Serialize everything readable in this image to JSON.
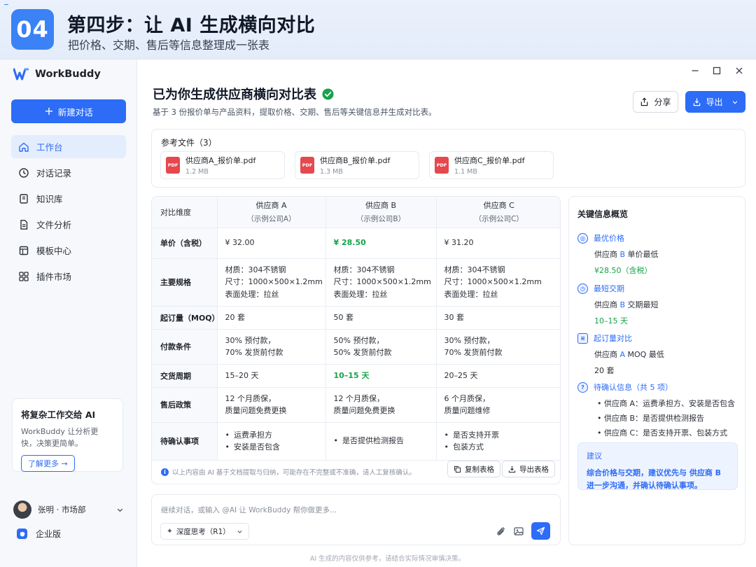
{
  "banner": {
    "step_number": "04",
    "title": "第四步：让 AI 生成横向对比",
    "subtitle": "把价格、交期、售后等信息整理成一张表"
  },
  "app": {
    "name": "WorkBuddy",
    "new_chat": "新建对话"
  },
  "sidebar": {
    "items": [
      {
        "label": "工作台",
        "icon": "home-icon"
      },
      {
        "label": "对话记录",
        "icon": "clock-icon"
      },
      {
        "label": "知识库",
        "icon": "book-icon"
      },
      {
        "label": "文件分析",
        "icon": "file-icon"
      },
      {
        "label": "模板中心",
        "icon": "template-icon"
      },
      {
        "label": "插件市场",
        "icon": "grid-icon"
      }
    ],
    "promo": {
      "title": "将复杂工作交给 AI",
      "desc": "WorkBuddy 让分析更快，决策更简单。",
      "button": "了解更多 →"
    },
    "user": {
      "name": "张明 · 市场部"
    },
    "edition": "企业版"
  },
  "main": {
    "title": "已为你生成供应商横向对比表",
    "subtitle": "基于 3 份报价单与产品资料，提取价格、交期、售后等关键信息并生成对比表。",
    "share": "分享",
    "export": "导出"
  },
  "refs": {
    "title": "参考文件（3）",
    "files": [
      {
        "name": "供应商A_报价单.pdf",
        "size": "1.2 MB"
      },
      {
        "name": "供应商B_报价单.pdf",
        "size": "1.3 MB"
      },
      {
        "name": "供应商C_报价单.pdf",
        "size": "1.1 MB"
      }
    ],
    "pdf_label": "PDF"
  },
  "table": {
    "dim_header": "对比维度",
    "columns": [
      {
        "name": "供应商 A",
        "sub": "（示例公司A）"
      },
      {
        "name": "供应商 B",
        "sub": "（示例公司B）"
      },
      {
        "name": "供应商 C",
        "sub": "（示例公司C）"
      }
    ],
    "rows": [
      {
        "dim": "单价（含税）",
        "cells": [
          [
            "¥ 32.00"
          ],
          [
            "¥ 28.50"
          ],
          [
            "¥ 31.20"
          ]
        ],
        "highlight": 1
      },
      {
        "dim": "主要规格",
        "cells": [
          [
            "材质：304不锈钢",
            "尺寸：1000×500×1.2mm",
            "表面处理：拉丝"
          ],
          [
            "材质：304不锈钢",
            "尺寸：1000×500×1.2mm",
            "表面处理：拉丝"
          ],
          [
            "材质：304不锈钢",
            "尺寸：1000×500×1.2mm",
            "表面处理：拉丝"
          ]
        ],
        "highlight": -1
      },
      {
        "dim": "起订量（MOQ）",
        "cells": [
          [
            "20 套"
          ],
          [
            "50 套"
          ],
          [
            "30 套"
          ]
        ],
        "highlight": -1
      },
      {
        "dim": "付款条件",
        "cells": [
          [
            "30% 预付款，",
            "70% 发货前付款"
          ],
          [
            "50% 预付款，",
            "50% 发货前付款"
          ],
          [
            "30% 预付款，",
            "70% 发货前付款"
          ]
        ],
        "highlight": -1
      },
      {
        "dim": "交货周期",
        "cells": [
          [
            "15–20 天"
          ],
          [
            "10–15 天"
          ],
          [
            "20–25 天"
          ]
        ],
        "highlight": 1
      },
      {
        "dim": "售后政策",
        "cells": [
          [
            "12 个月质保，",
            "质量问题免费更换"
          ],
          [
            "12 个月质保，",
            "质量问题免费更换"
          ],
          [
            "6 个月质保，",
            "质量问题维修"
          ]
        ],
        "highlight": -1
      },
      {
        "dim": "待确认事项",
        "cells": [
          [
            "运费承担方",
            "安装是否包含"
          ],
          [
            "是否提供检测报告"
          ],
          [
            "是否支持开票",
            "包装方式"
          ]
        ],
        "highlight": -1,
        "bullets": true
      }
    ],
    "note": "以上内容由 AI 基于文档提取与归纳，可能存在不完整或不准确，请人工复核确认。",
    "copy_btn": "复制表格",
    "export_btn": "导出表格"
  },
  "panel": {
    "title": "关键信息概览",
    "best_price": {
      "head": "最优价格",
      "line1_pre": "供应商 ",
      "line1_hl": "B",
      "line1_post": " 单价最低",
      "line2": "¥28.50（含税）"
    },
    "fastest": {
      "head": "最短交期",
      "line1_pre": "供应商 ",
      "line1_hl": "B",
      "line1_post": " 交期最短",
      "line2": "10–15 天"
    },
    "moq": {
      "head": "起订量对比",
      "line1_pre": "供应商 ",
      "line1_hl": "A",
      "line1_post": "  MOQ 最低",
      "line2": "20 套"
    },
    "pending": {
      "head": "待确认信息（共 5 项）",
      "items": [
        "供应商 A：运费承担方、安装是否包含",
        "供应商 B：是否提供检测报告",
        "供应商 C：是否支持开票、包装方式"
      ]
    },
    "advice": {
      "title": "建议",
      "text1": "综合价格与交期，建议优先与 供应商 B",
      "text2": "进一步沟通，并确认待确认事项。"
    }
  },
  "chat": {
    "placeholder": "继续对话，或输入 @AI 让 WorkBuddy 帮你做更多...",
    "think": "深度思考（R1）"
  },
  "disclaimer": "AI 生成的内容仅供参考，请结合实际情况审慎决策。",
  "colors": {
    "accent": "#2d6cf6",
    "green": "#16a34a",
    "pdf": "#e5484d"
  }
}
